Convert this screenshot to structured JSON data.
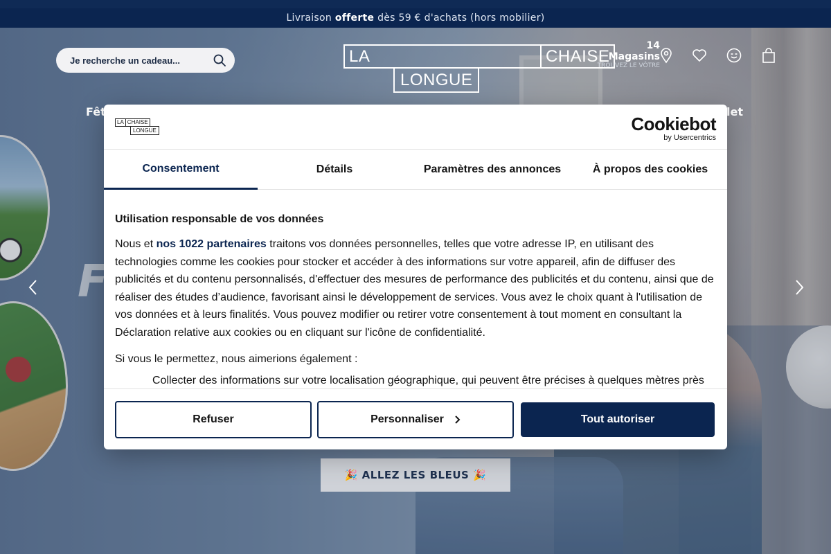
{
  "announcement": {
    "pre": "Livraison ",
    "bold": "offerte",
    "post": " dès 59 € d'achats (hors mobilier)"
  },
  "header": {
    "search_placeholder": "Je recherche un cadeau...",
    "logo": {
      "line1a": "LA",
      "line1b": "CHAISE",
      "line2": "LONGUE"
    },
    "stores": {
      "title": "14 Magasins",
      "subtitle": "TROUVEZ LE VÔTRE"
    },
    "icons": [
      "location-pin-icon",
      "heart-icon",
      "account-icon",
      "shopping-bag-icon"
    ]
  },
  "nav_peek": {
    "left": "Fêt",
    "right": "utlet"
  },
  "hero": {
    "deco_text": "FI",
    "cta_label": "🎉 ALLEZ LES BLEUS 🎉"
  },
  "cookie": {
    "brand": {
      "l1a": "LA",
      "l1b": "CHAISE",
      "l2": "LONGUE"
    },
    "cookiebot": {
      "name": "Cookiebot",
      "by": "by Usercentrics"
    },
    "tabs": [
      "Consentement",
      "Détails",
      "Paramètres des annonces",
      "À propos des cookies"
    ],
    "heading": "Utilisation responsable de vos données",
    "para1_pre": "Nous et ",
    "para1_link": "nos 1022 partenaires",
    "para1_post": " traitons vos données personnelles, telles que votre adresse IP, en utilisant des technologies comme les cookies pour stocker et accéder à des informations sur votre appareil, afin de diffuser des publicités et du contenu personnalisés, d'effectuer des mesures de performance des publicités et du contenu, ainsi que de réaliser des études d’audience, favorisant ainsi le développement de services. Vous avez le choix quant à l'utilisation de vos données et à leurs finalités. Vous pouvez modifier ou retirer votre consentement à tout moment en consultant la Déclaration relative aux cookies ou en cliquant sur l'icône de confidentialité.",
    "para2": "Si vous le permettez, nous aimerions également :",
    "bullet": "Collecter des informations sur votre localisation géographique, qui peuvent être précises à quelques mètres près",
    "buttons": {
      "refuse": "Refuser",
      "customize": "Personnaliser",
      "accept": "Tout autoriser"
    }
  },
  "colors": {
    "navy": "#0b2550",
    "white": "#ffffff"
  }
}
